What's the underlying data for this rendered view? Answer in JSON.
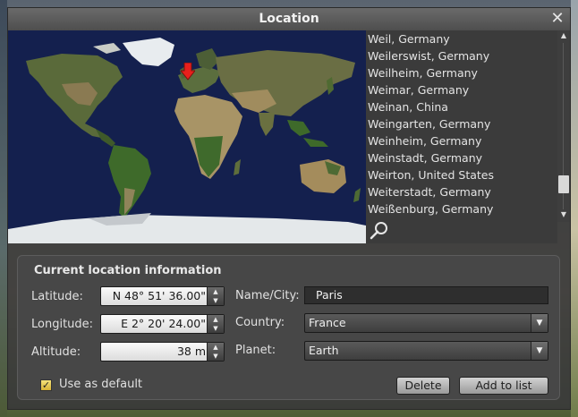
{
  "window": {
    "title": "Location"
  },
  "cities": [
    "Weil, Germany",
    "Weilerswist, Germany",
    "Weilheim, Germany",
    "Weimar, Germany",
    "Weinan, China",
    "Weingarten, Germany",
    "Weinheim, Germany",
    "Weinstadt, Germany",
    "Weirton, United States",
    "Weiterstadt, Germany",
    "Weißenburg, Germany"
  ],
  "info": {
    "title": "Current location information",
    "latitude_label": "Latitude:",
    "latitude_value": "N 48° 51' 36.00\"",
    "longitude_label": "Longitude:",
    "longitude_value": "E 2° 20' 24.00\"",
    "altitude_label": "Altitude:",
    "altitude_value": "38 m",
    "name_label": "Name/City:",
    "name_value": "Paris",
    "country_label": "Country:",
    "country_value": "France",
    "planet_label": "Planet:",
    "planet_value": "Earth",
    "default_label": "Use as default",
    "delete_label": "Delete",
    "add_label": "Add to list"
  },
  "colors": {
    "ocean": "#14204e",
    "marker": "#e8201c",
    "checkbox": "#e6c84a"
  },
  "icons": {
    "close": "close-icon",
    "search": "search-icon",
    "marker": "location-marker-icon"
  }
}
